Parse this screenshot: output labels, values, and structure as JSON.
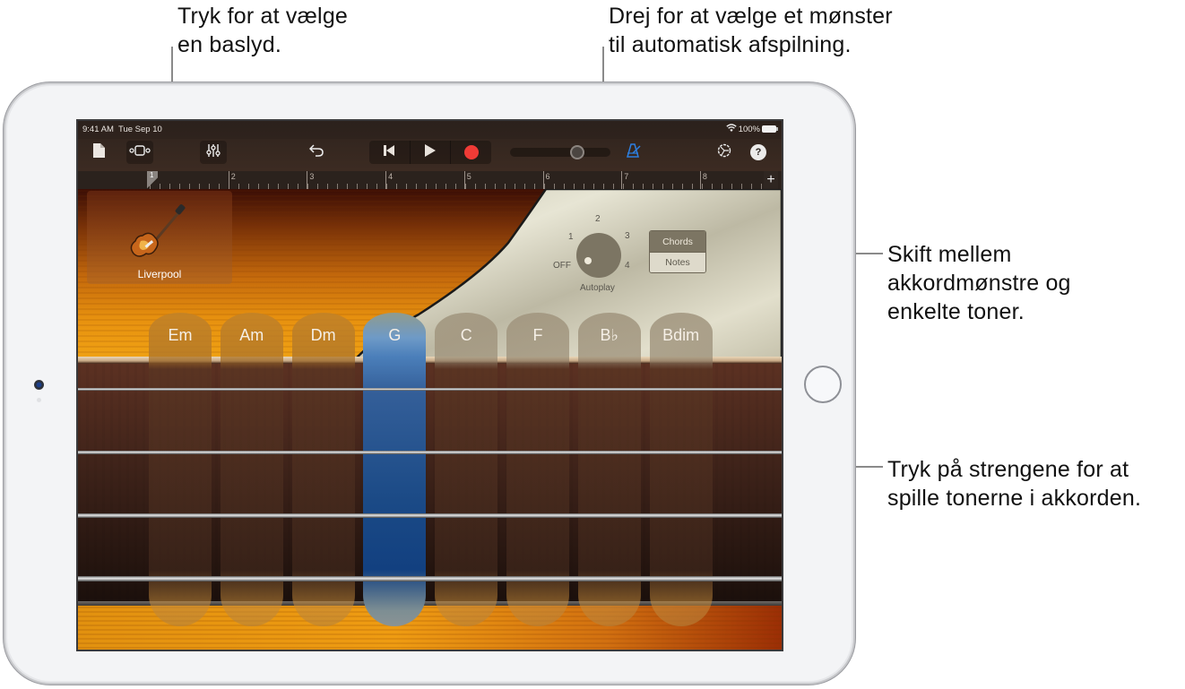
{
  "callouts": {
    "sound": "Tryk for at vælge\nen baslyd.",
    "autoplay": "Drej for at vælge et mønster\ntil automatisk afspilning.",
    "mode": "Skift mellem\nakkordmønstre og\nenkelte toner.",
    "strings": "Tryk på strengene for at\nspille tonerne i akkorden."
  },
  "status_bar": {
    "time": "9:41 AM",
    "date": "Tue Sep 10",
    "wifi_icon": "wifi-icon",
    "battery": "100%"
  },
  "toolbar": {
    "browser_icon": "document-icon",
    "view_icon": "tracks-view-icon",
    "mixer_icon": "mixer-sliders-icon",
    "undo_icon": "undo-icon",
    "rewind_icon": "skip-back-icon",
    "play_icon": "play-icon",
    "record_icon": "record-icon",
    "metronome_icon": "metronome-icon",
    "settings_icon": "settings-gear-icon",
    "help_label": "?",
    "master_volume": 0.7,
    "accent_color": "#2d7fe0",
    "record_color": "#ef3b36"
  },
  "ruler": {
    "bars": [
      "1",
      "2",
      "3",
      "4",
      "5",
      "6",
      "7",
      "8"
    ],
    "add_label": "+"
  },
  "instrument": {
    "name": "Liverpool",
    "icon": "bass-guitar-icon"
  },
  "autoplay": {
    "label": "Autoplay",
    "positions": [
      "OFF",
      "1",
      "2",
      "3",
      "4"
    ],
    "selected": "OFF"
  },
  "mode_toggle": {
    "options": [
      "Chords",
      "Notes"
    ],
    "selected": "Chords"
  },
  "chords": [
    {
      "label": "Em",
      "active": false
    },
    {
      "label": "Am",
      "active": false
    },
    {
      "label": "Dm",
      "active": false
    },
    {
      "label": "G",
      "active": true
    },
    {
      "label": "C",
      "active": false
    },
    {
      "label": "F",
      "active": false
    },
    {
      "label": "B♭",
      "active": false
    },
    {
      "label": "Bdim",
      "active": false
    }
  ],
  "strings_count": 4,
  "active_chord_color": "#2f62a6"
}
